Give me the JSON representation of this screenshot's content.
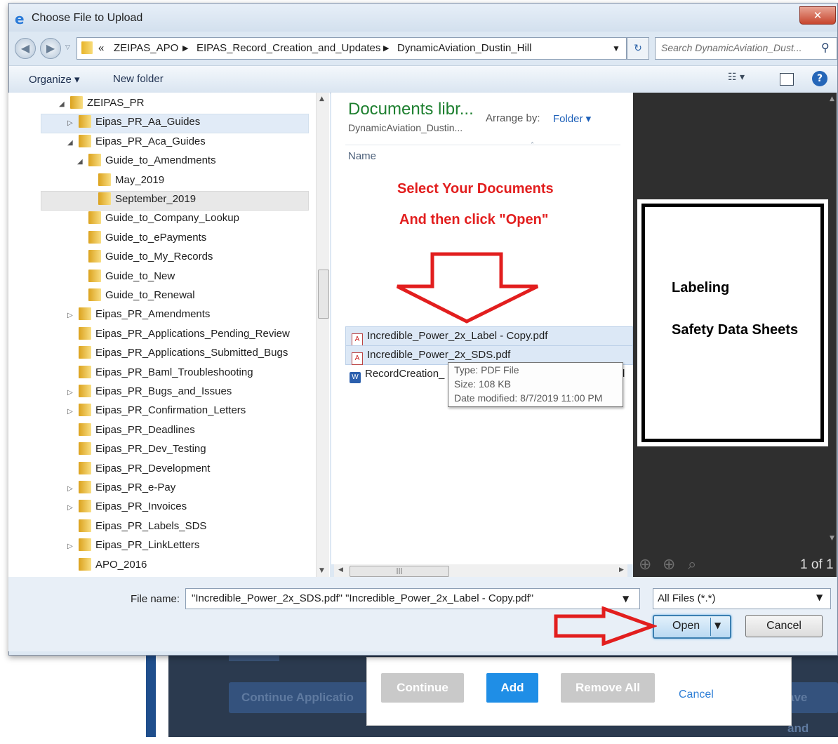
{
  "window": {
    "title": "Choose File to Upload",
    "close_icon": "close-icon"
  },
  "address": {
    "overflow": "«",
    "crumbs": [
      "ZEIPAS_APO",
      "EIPAS_Record_Creation_and_Updates",
      "DynamicAviation_Dustin_Hill"
    ],
    "search_placeholder": "Search DynamicAviation_Dust..."
  },
  "toolbar": {
    "organize": "Organize ▾",
    "new_folder": "New folder"
  },
  "tree": [
    {
      "label": "ZEIPAS_PR",
      "level": 0,
      "expander": "◢"
    },
    {
      "label": "Eipas_PR_Aa_Guides",
      "level": 1,
      "expander": "▷"
    },
    {
      "label": "Eipas_PR_Aca_Guides",
      "level": 1,
      "expander": "◢"
    },
    {
      "label": "Guide_to_Amendments",
      "level": 2,
      "expander": "◢"
    },
    {
      "label": "May_2019",
      "level": 3,
      "expander": ""
    },
    {
      "label": "September_2019",
      "level": 3,
      "expander": ""
    },
    {
      "label": "Guide_to_Company_Lookup",
      "level": 2,
      "expander": ""
    },
    {
      "label": "Guide_to_ePayments",
      "level": 2,
      "expander": ""
    },
    {
      "label": "Guide_to_My_Records",
      "level": 2,
      "expander": ""
    },
    {
      "label": "Guide_to_New",
      "level": 2,
      "expander": ""
    },
    {
      "label": "Guide_to_Renewal",
      "level": 2,
      "expander": ""
    },
    {
      "label": "Eipas_PR_Amendments",
      "level": 1,
      "expander": "▷"
    },
    {
      "label": "Eipas_PR_Applications_Pending_Review",
      "level": 1,
      "expander": ""
    },
    {
      "label": "Eipas_PR_Applications_Submitted_Bugs",
      "level": 1,
      "expander": ""
    },
    {
      "label": "Eipas_PR_Baml_Troubleshooting",
      "level": 1,
      "expander": ""
    },
    {
      "label": "Eipas_PR_Bugs_and_Issues",
      "level": 1,
      "expander": "▷"
    },
    {
      "label": "Eipas_PR_Confirmation_Letters",
      "level": 1,
      "expander": "▷"
    },
    {
      "label": "Eipas_PR_Deadlines",
      "level": 1,
      "expander": ""
    },
    {
      "label": "Eipas_PR_Dev_Testing",
      "level": 1,
      "expander": ""
    },
    {
      "label": "Eipas_PR_Development",
      "level": 1,
      "expander": ""
    },
    {
      "label": "Eipas_PR_e-Pay",
      "level": 1,
      "expander": "▷"
    },
    {
      "label": "Eipas_PR_Invoices",
      "level": 1,
      "expander": "▷"
    },
    {
      "label": "Eipas_PR_Labels_SDS",
      "level": 1,
      "expander": ""
    },
    {
      "label": "Eipas_PR_LinkLetters",
      "level": 1,
      "expander": "▷"
    },
    {
      "label": "APO_2016",
      "level": 0,
      "expander": ""
    }
  ],
  "library": {
    "title": "Documents libr...",
    "subtitle": "DynamicAviation_Dustin...",
    "arrange_label": "Arrange by:",
    "arrange_value": "Folder ▾",
    "column": "Name"
  },
  "annotations": {
    "line1": "Select Your Documents",
    "line2": "And then click \"Open\""
  },
  "files": [
    {
      "name": "Incredible_Power_2x_Label - Copy.pdf",
      "icon": "pdf-icon",
      "selected": true
    },
    {
      "name": "Incredible_Power_2x_SDS.pdf",
      "icon": "pdf-icon",
      "selected": true
    },
    {
      "name": "RecordCreation_",
      "icon": "word-doc-icon",
      "selected": false,
      "tail": "d"
    }
  ],
  "tooltip": {
    "type": "Type: PDF File",
    "size": "Size: 108 KB",
    "modified": "Date modified: 8/7/2019 11:00 PM"
  },
  "preview": {
    "line1": "Labeling",
    "line2": "Safety Data Sheets",
    "page_count": "1 of 1"
  },
  "bottom": {
    "file_name_label": "File name:",
    "file_name_value": "\"Incredible_Power_2x_SDS.pdf\" \"Incredible_Power_2x_Label - Copy.pdf\"",
    "filter": "All Files (*.*)",
    "open": "Open",
    "cancel": "Cancel"
  },
  "background_page": {
    "continue_application": "Continue Applicatio",
    "save_and": "ave and",
    "modal": {
      "continue": "Continue",
      "add": "Add",
      "remove_all": "Remove All",
      "cancel": "Cancel"
    }
  },
  "colors": {
    "accent_red": "#e21e1e",
    "library_green": "#1d7f2f",
    "add_blue": "#1f8ee6"
  }
}
